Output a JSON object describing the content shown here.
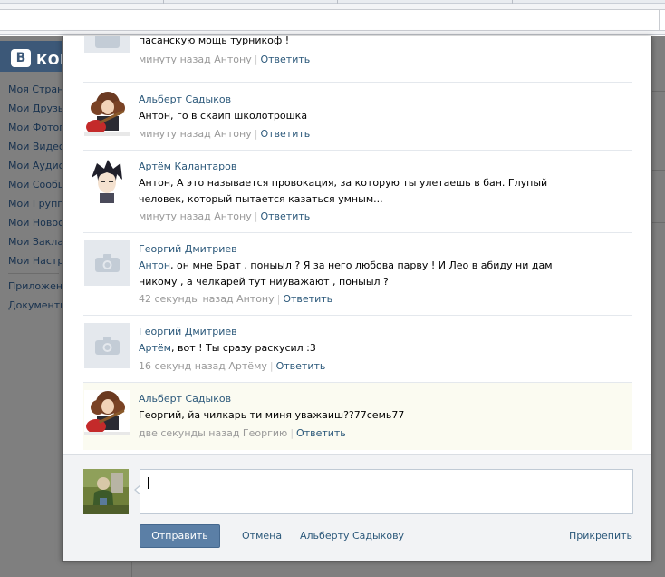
{
  "sidebar": {
    "logo_mark": "В",
    "logo_text": "КОН",
    "items": [
      {
        "label": "Моя Страни"
      },
      {
        "label": "Мои Друзья"
      },
      {
        "label": "Мои Фотогр"
      },
      {
        "label": "Мои Видеоз"
      },
      {
        "label": "Мои Аудиоз"
      },
      {
        "label": "Мои Сообще"
      },
      {
        "label": "Мои Группы"
      },
      {
        "label": "Мои Новост"
      },
      {
        "label": "Мои Заклад"
      },
      {
        "label": "Мои Настро"
      }
    ],
    "extra": [
      {
        "label": "Приложени"
      },
      {
        "label": "Документы"
      }
    ]
  },
  "comments": [
    {
      "author": "",
      "text": "пасанскую мощь турникоф !",
      "time": "минуту назад Антону",
      "reply": "Ответить"
    },
    {
      "author": "Альберт Садыков",
      "text": "Антон, го в скаип школотрошка",
      "time": "минуту назад Антону",
      "reply": "Ответить"
    },
    {
      "author": "Артём Калантаров",
      "text": "Антон, А это называется провокация, за которую ты улетаешь в бан. Глупый человек, который пытается казаться умным...",
      "time": "минуту назад Антону",
      "reply": "Ответить"
    },
    {
      "author": "Георгий Дмитриев",
      "mention": "Антон",
      "text": ", он мне Брат , поныыл ? Я за него любова парву ! И Лео в абиду ни дам никому , а челкарей тут ниуважают , поныыл ?",
      "time": "42 секунды назад Антону",
      "reply": "Ответить"
    },
    {
      "author": "Георгий Дмитриев",
      "mention": "Артём",
      "text": ", вот ! Ты сразу раскусил :3",
      "time": "16 секунд назад Артёму",
      "reply": "Ответить"
    },
    {
      "author": "Альберт Садыков",
      "text": "Георгий, йа чилкарь ти миня уважаиш??77семь77",
      "time": "две секунды назад Георгию",
      "reply": "Ответить"
    }
  ],
  "reply_form": {
    "send_label": "Отправить",
    "cancel_label": "Отмена",
    "to_label": "Альберту Садыкову",
    "attach_label": "Прикрепить"
  },
  "colors": {
    "link": "#2b587a",
    "meta": "#999999",
    "button": "#5b7fa6",
    "highlight": "#fbfbf1",
    "overlay": "#7f7f7f"
  },
  "icons": {
    "placeholder": "camera-icon"
  }
}
